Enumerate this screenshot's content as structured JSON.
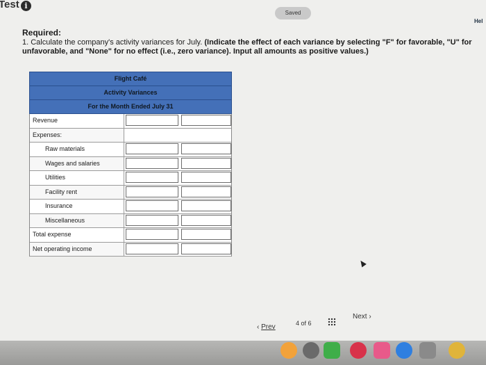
{
  "header": {
    "title": "Test",
    "info_icon": "info-icon",
    "saved_label": "Saved",
    "help_label": "Hel"
  },
  "required": {
    "title": "Required:",
    "text_start": "1. Calculate the company's activity variances for July.",
    "text_bold": " (Indicate the effect of each variance by selecting \"F\" for favorable, \"U\" for unfavorable, and \"None\" for no effect (i.e., zero variance). Input all amounts as positive values.)"
  },
  "report": {
    "company": "Flight Café",
    "title": "Activity Variances",
    "period": "For the Month Ended July 31",
    "rows": [
      {
        "label": "Revenue",
        "indent": false
      },
      {
        "label": "Expenses:",
        "indent": false
      },
      {
        "label": "Raw materials",
        "indent": true
      },
      {
        "label": "Wages and salaries",
        "indent": true
      },
      {
        "label": "Utilities",
        "indent": true
      },
      {
        "label": "Facility rent",
        "indent": true
      },
      {
        "label": "Insurance",
        "indent": true
      },
      {
        "label": "Miscellaneous",
        "indent": true
      },
      {
        "label": "Total expense",
        "indent": false
      },
      {
        "label": "Net operating income",
        "indent": false
      }
    ]
  },
  "pagination": {
    "prev_label": "Prev",
    "page_indicator": "4 of 6",
    "next_label": "Next"
  },
  "colors": {
    "header_band": "#4470b8",
    "page_bg": "#efefed"
  }
}
